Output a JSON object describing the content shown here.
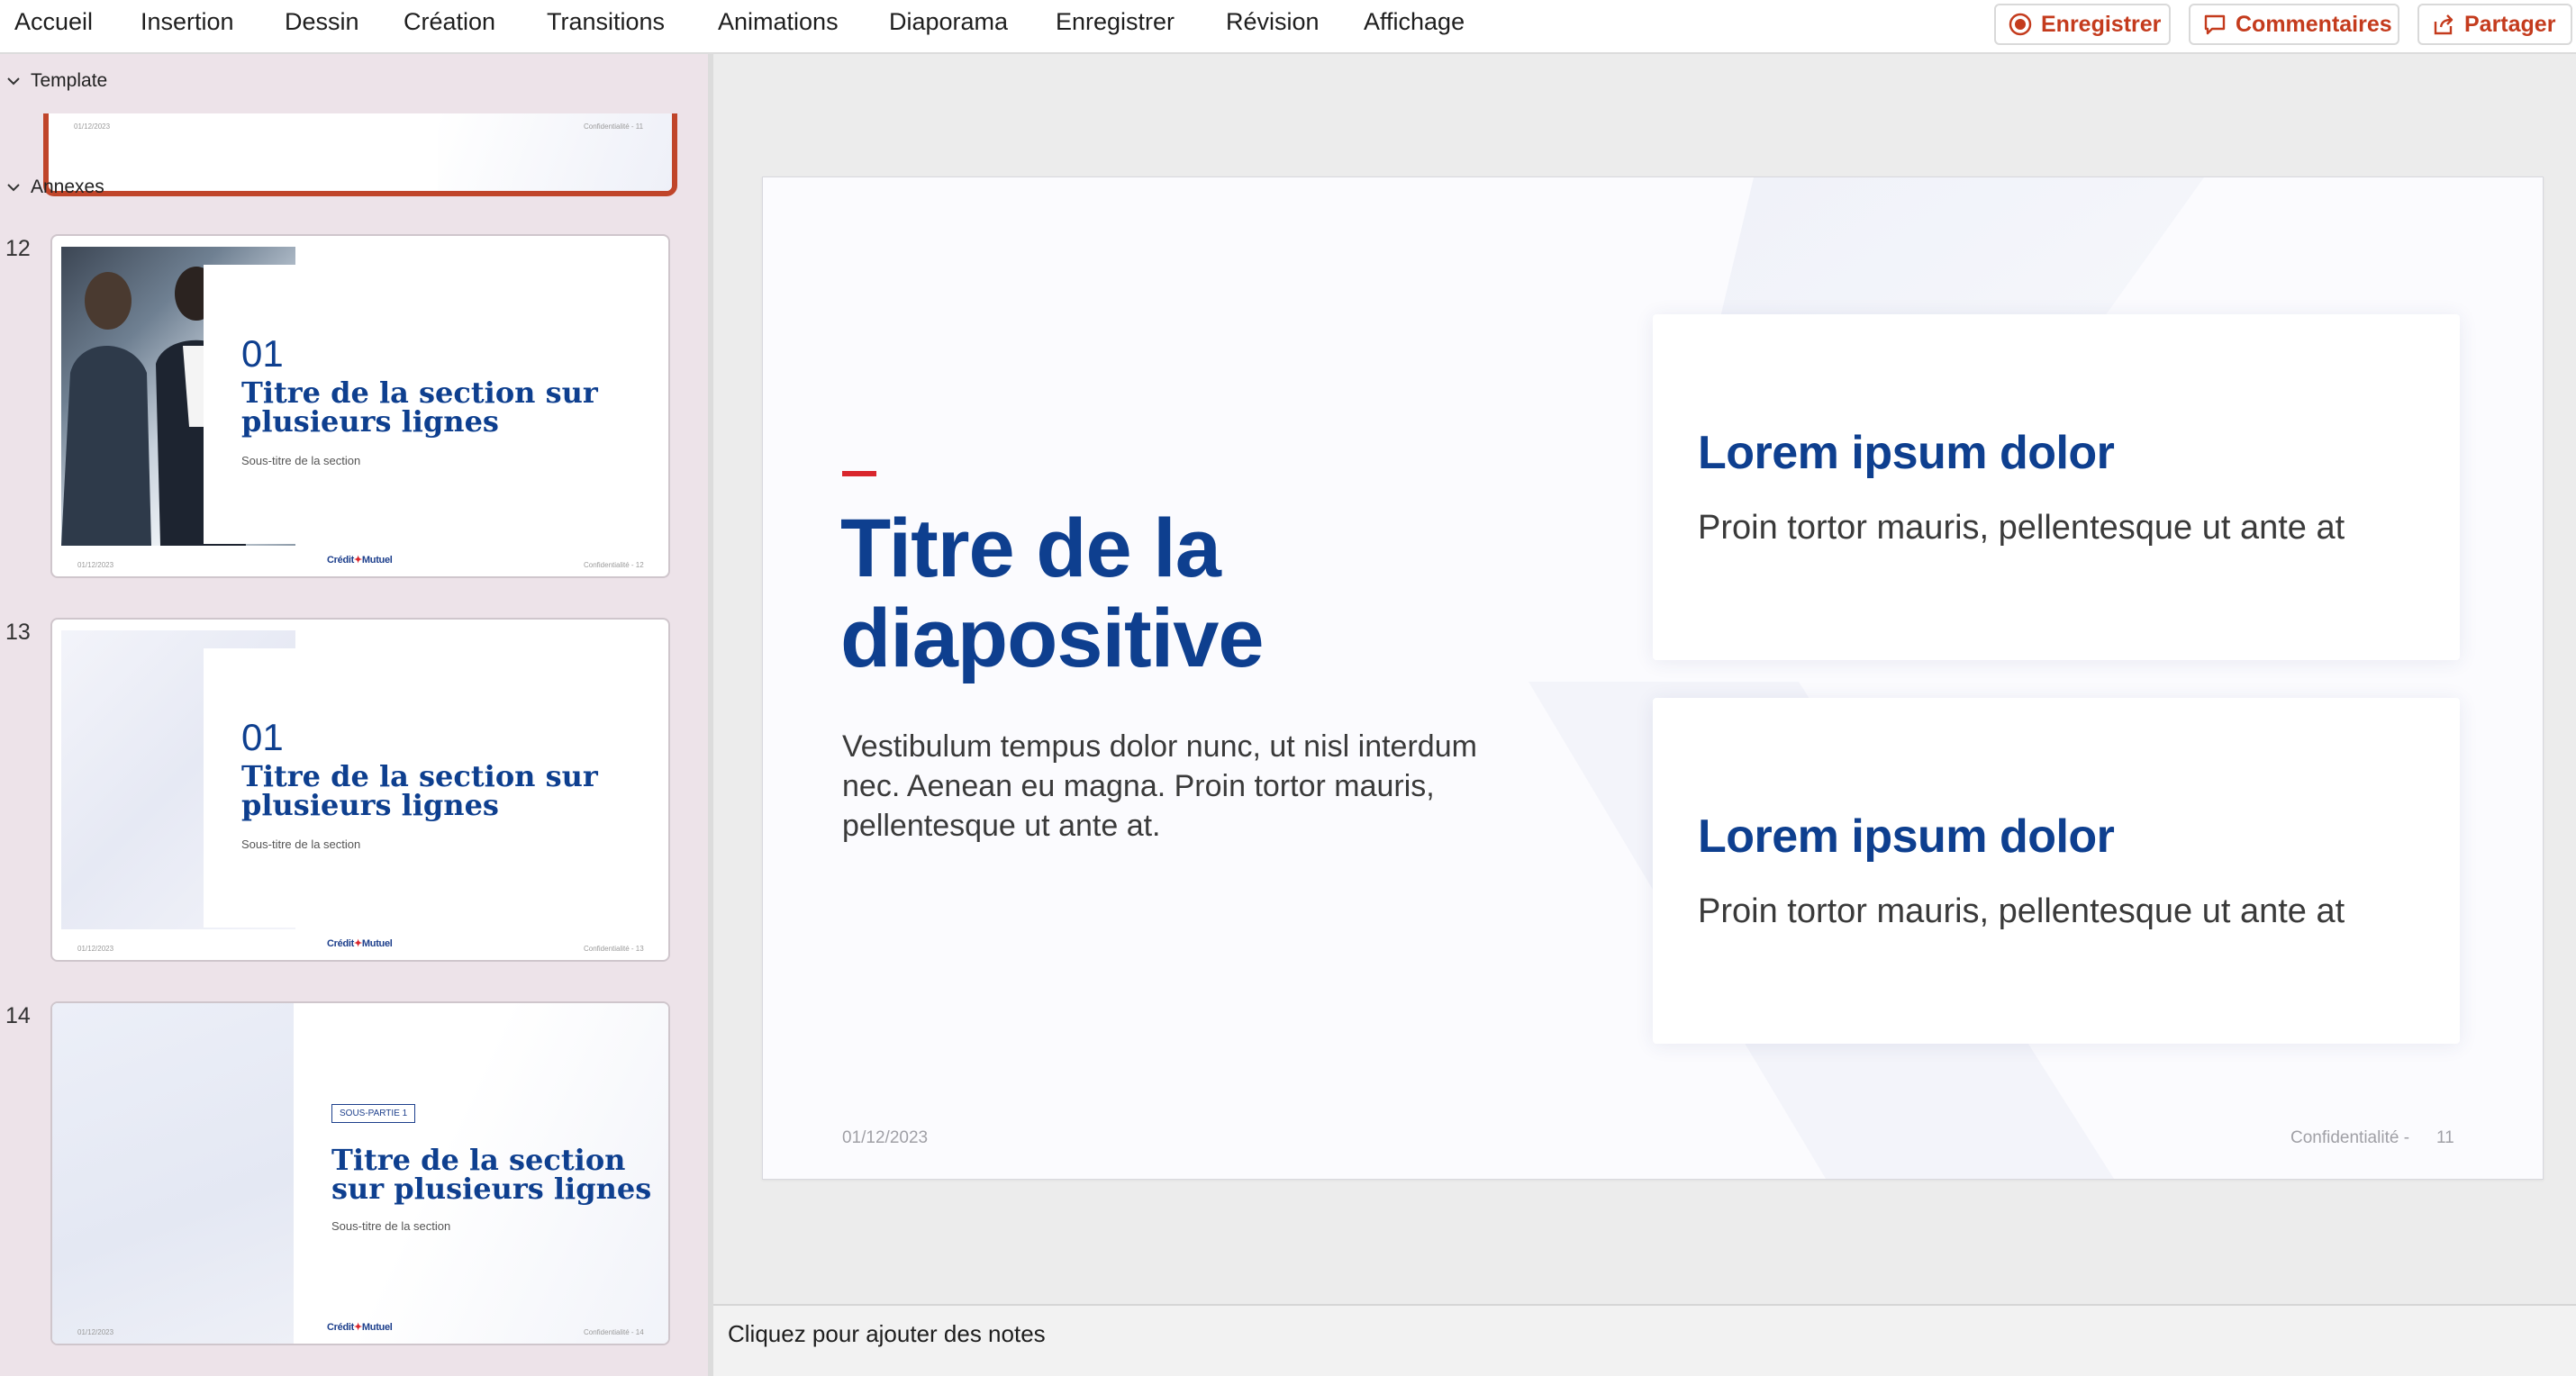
{
  "ribbon": {
    "tabs": [
      "Accueil",
      "Insertion",
      "Dessin",
      "Création",
      "Transitions",
      "Animations",
      "Diaporama",
      "Enregistrer",
      "Révision",
      "Affichage"
    ],
    "record_label": "Enregistrer",
    "comments_label": "Commentaires",
    "share_label": "Partager"
  },
  "thumbnails": {
    "section_template": "Template",
    "section_annexes": "Annexes",
    "slide12": {
      "number": "12",
      "section_number": "01",
      "title_line1": "Titre de la section sur",
      "title_line2": "plusieurs lignes",
      "subtitle": "Sous-titre de la section",
      "date": "01/12/2023",
      "confidentiality": "Confidentialité - 12",
      "logo_a": "Crédit",
      "logo_b": "Mutuel"
    },
    "slide13": {
      "number": "13",
      "section_number": "01",
      "title_line1": "Titre de la section sur",
      "title_line2": "plusieurs lignes",
      "subtitle": "Sous-titre de la section",
      "date": "01/12/2023",
      "confidentiality": "Confidentialité - 13",
      "logo_a": "Crédit",
      "logo_b": "Mutuel"
    },
    "slide14": {
      "number": "14",
      "tag": "SOUS-PARTIE 1",
      "title_line1": "Titre de la section",
      "title_line2": "sur plusieurs lignes",
      "subtitle": "Sous-titre de la section",
      "date": "01/12/2023",
      "confidentiality": "Confidentialité - 14",
      "logo_a": "Crédit",
      "logo_b": "Mutuel"
    },
    "template_thumb": {
      "date": "01/12/2023",
      "confidentiality": "Confidentialité - 11"
    }
  },
  "slide": {
    "title_line1": "Titre de la",
    "title_line2": "diapositive",
    "body_line1": "Vestibulum tempus dolor nunc, ut nisl interdum",
    "body_line2": "nec. Aenean eu magna. Proin tortor mauris,",
    "body_line3": "pellentesque ut ante at.",
    "card1": {
      "title": "Lorem ipsum dolor",
      "body": "Proin tortor mauris, pellentesque ut ante at"
    },
    "card2": {
      "title": "Lorem ipsum dolor",
      "body": "Proin tortor mauris, pellentesque ut ante at"
    },
    "footer_date": "01/12/2023",
    "footer_confidentiality": "Confidentialité -",
    "footer_page": "11"
  },
  "notes": {
    "placeholder": "Cliquez pour ajouter des notes"
  },
  "colors": {
    "brand_blue": "#0e3f8f",
    "accent_red": "#d9262d",
    "ribbon_button_text": "#c43b1d",
    "thumbnail_pane_bg": "#ede3e9",
    "selected_thumbnail_border": "#c0452a"
  }
}
